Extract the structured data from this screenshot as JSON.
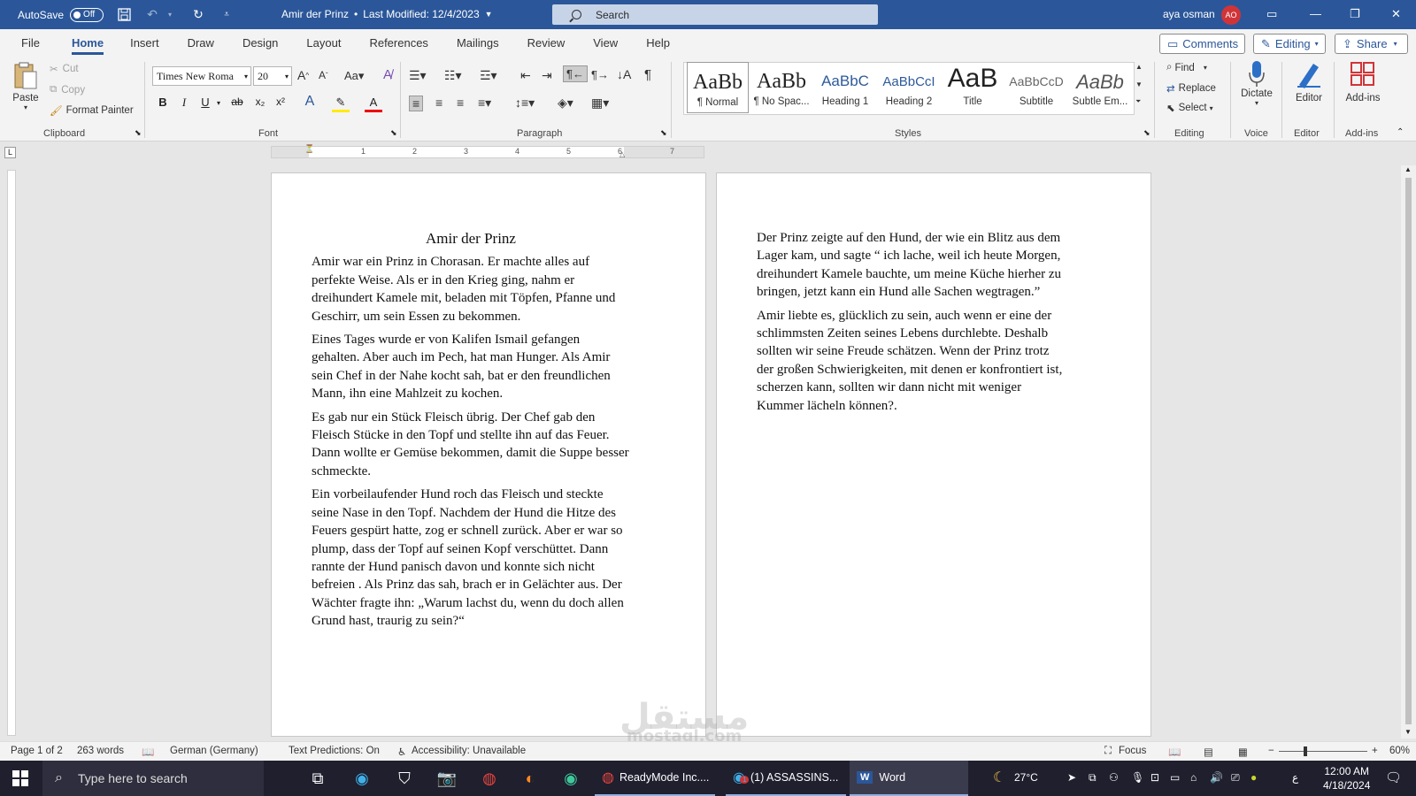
{
  "titlebar": {
    "autosave_label": "AutoSave",
    "autosave_state": "Off",
    "doc_title": "Amir der Prinz",
    "last_modified": "Last Modified: 12/4/2023",
    "search_label": "Search",
    "user_name": "aya osman",
    "user_initials": "AO"
  },
  "tabs": [
    "File",
    "Home",
    "Insert",
    "Draw",
    "Design",
    "Layout",
    "References",
    "Mailings",
    "Review",
    "View",
    "Help"
  ],
  "active_tab": "Home",
  "top_buttons": {
    "comments": "Comments",
    "editing": "Editing",
    "share": "Share"
  },
  "ribbon": {
    "clipboard": {
      "paste": "Paste",
      "cut": "Cut",
      "copy": "Copy",
      "format_painter": "Format Painter",
      "label": "Clipboard"
    },
    "font": {
      "family": "Times New Roma",
      "size": "20",
      "label": "Font",
      "bold": "B",
      "italic": "I",
      "underline": "U",
      "strike": "ab",
      "subscript": "x₂",
      "superscript": "x²"
    },
    "paragraph": {
      "label": "Paragraph"
    },
    "styles": {
      "label": "Styles",
      "items": [
        {
          "sample": "AaBb",
          "name": "¶ Normal"
        },
        {
          "sample": "AaBb",
          "name": "¶ No Spac..."
        },
        {
          "sample": "AaBbC",
          "name": "Heading 1"
        },
        {
          "sample": "AaBbCcI",
          "name": "Heading 2"
        },
        {
          "sample": "AaB",
          "name": "Title"
        },
        {
          "sample": "AaBbCcD",
          "name": "Subtitle"
        },
        {
          "sample": "AaBb",
          "name": "Subtle Em..."
        }
      ]
    },
    "editing": {
      "find": "Find",
      "replace": "Replace",
      "select": "Select",
      "label": "Editing"
    },
    "voice": {
      "dictate": "Dictate",
      "label": "Voice"
    },
    "editor": {
      "button": "Editor",
      "label": "Editor"
    },
    "addins": {
      "button": "Add-ins",
      "label": "Add-ins"
    }
  },
  "ruler_numbers": [
    "1",
    "2",
    "3",
    "4",
    "5",
    "6",
    "7"
  ],
  "document": {
    "page1": {
      "title": "Amir der Prinz",
      "paragraphs": [
        "Amir war ein Prinz in Chorasan. Er machte alles auf perfekte Weise. Als er in den Krieg ging, nahm er dreihundert Kamele mit, beladen mit Töpfen, Pfanne und Geschirr, um sein Essen zu bekommen.",
        "Eines Tages wurde er von Kalifen Ismail gefangen gehalten. Aber auch im Pech, hat man Hunger. Als Amir sein Chef in der Nahe kocht sah, bat er den freundlichen Mann, ihn eine Mahlzeit zu kochen.",
        "Es gab nur ein Stück Fleisch übrig. Der Chef gab den Fleisch Stücke in den Topf und stellte ihn auf das Feuer. Dann wollte er Gemüse bekommen, damit die Suppe besser schmeckte.",
        "Ein vorbeilaufender Hund roch das Fleisch und steckte seine Nase in den Topf. Nachdem der Hund die Hitze des Feuers gespürt hatte, zog er schnell zurück. Aber er war so plump, dass der Topf auf seinen Kopf verschüttet. Dann rannte der Hund panisch davon und konnte sich nicht befreien . Als Prinz das sah, brach er in Gelächter aus. Der Wächter fragte ihn: „Warum lachst du, wenn du doch allen Grund hast, traurig zu sein?“"
      ]
    },
    "page2": {
      "paragraphs": [
        "Der Prinz zeigte auf den Hund, der wie ein Blitz aus dem Lager kam, und sagte “ ich lache, weil ich heute Morgen, dreihundert Kamele bauchte, um meine Küche hierher zu bringen, jetzt kann ein Hund alle Sachen wegtragen.”",
        "Amir liebte es, glücklich zu sein, auch wenn er eine der schlimmsten Zeiten seines Lebens durchlebte. Deshalb sollten wir seine Freude schätzen. Wenn der Prinz trotz der großen Schwierigkeiten, mit denen er konfrontiert ist, scherzen kann, sollten wir dann nicht mit weniger Kummer lächeln können?."
      ]
    }
  },
  "statusbar": {
    "page": "Page 1 of 2",
    "words": "263 words",
    "language": "German (Germany)",
    "text_predictions": "Text Predictions: On",
    "accessibility": "Accessibility: Unavailable",
    "focus": "Focus",
    "zoom": "60%"
  },
  "taskbar": {
    "search_placeholder": "Type here to search",
    "windows": [
      "ReadyMode Inc....",
      "(1) ASSASSINS...",
      "Word"
    ],
    "notification_badge": "1",
    "weather": "27°C",
    "time": "12:00 AM",
    "date": "4/18/2024",
    "lang_indicator": "ع"
  },
  "watermark": {
    "text": "مستقل",
    "sub": "mostaql.com"
  },
  "colors": {
    "word_blue": "#2b579a",
    "taskbar": "#1f1f2e",
    "avatar": "#d13438"
  }
}
